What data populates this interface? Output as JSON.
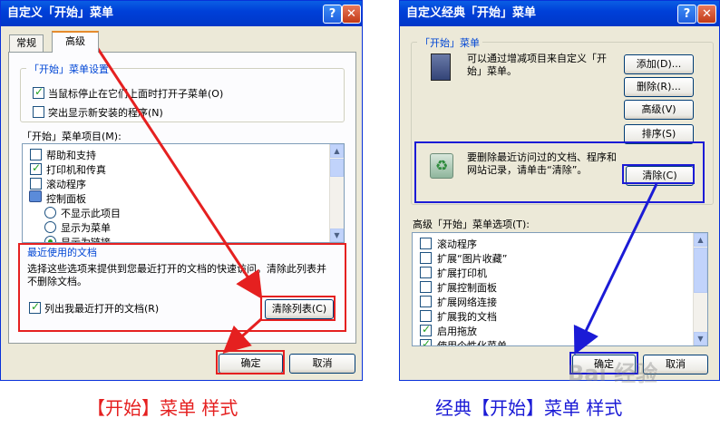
{
  "left": {
    "title": "自定义「开始」菜单",
    "tabs": [
      "常规",
      "高级"
    ],
    "settings_group": "「开始」菜单设置",
    "settings": [
      {
        "label": "当鼠标停止在它们上面时打开子菜单(O)",
        "checked": true
      },
      {
        "label": "突出显示新安装的程序(N)",
        "checked": false
      }
    ],
    "items_label": "「开始」菜单项目(M):",
    "items": [
      {
        "kind": "check",
        "label": "帮助和支持",
        "checked": false
      },
      {
        "kind": "check",
        "label": "打印机和传真",
        "checked": true
      },
      {
        "kind": "check",
        "label": "滚动程序",
        "checked": false
      },
      {
        "kind": "icon",
        "label": "控制面板"
      },
      {
        "kind": "radio",
        "label": "不显示此项目",
        "checked": false
      },
      {
        "kind": "radio",
        "label": "显示为菜单",
        "checked": false
      },
      {
        "kind": "radio",
        "label": "显示为链接",
        "checked": true
      }
    ],
    "recent_group": "最近使用的文档",
    "recent_desc": "选择这些选项来提供到您最近打开的文档的快速访问。清除此列表并不删除文档。",
    "recent_check": "列出我最近打开的文档(R)",
    "clear_list": "清除列表(C)",
    "ok": "确定",
    "cancel": "取消"
  },
  "right": {
    "title": "自定义经典「开始」菜单",
    "menu_group": "「开始」菜单",
    "menu_desc": "可以通过增减项目来自定义「开始」菜单。",
    "add": "添加(D)...",
    "remove": "删除(R)...",
    "advanced": "高级(V)",
    "sort": "排序(S)",
    "clear_desc": "要删除最近访问过的文档、程序和网站记录，请单击“清除”。",
    "clear": "清除(C)",
    "options_label": "高级「开始」菜单选项(T):",
    "options": [
      {
        "label": "滚动程序",
        "checked": false
      },
      {
        "label": "扩展“图片收藏”",
        "checked": false
      },
      {
        "label": "扩展打印机",
        "checked": false
      },
      {
        "label": "扩展控制面板",
        "checked": false
      },
      {
        "label": "扩展网络连接",
        "checked": false
      },
      {
        "label": "扩展我的文档",
        "checked": false
      },
      {
        "label": "启用拖放",
        "checked": true
      },
      {
        "label": "使用个性化菜单",
        "checked": true
      }
    ],
    "ok": "确定",
    "cancel": "取消"
  },
  "captions": {
    "left": "【开始】菜单  样式",
    "right": "经典【开始】菜单  样式"
  },
  "watermark": "Bai 经验",
  "colors": {
    "red": "#E52020",
    "blue": "#1B1BD6",
    "accent": "#0046D5"
  }
}
